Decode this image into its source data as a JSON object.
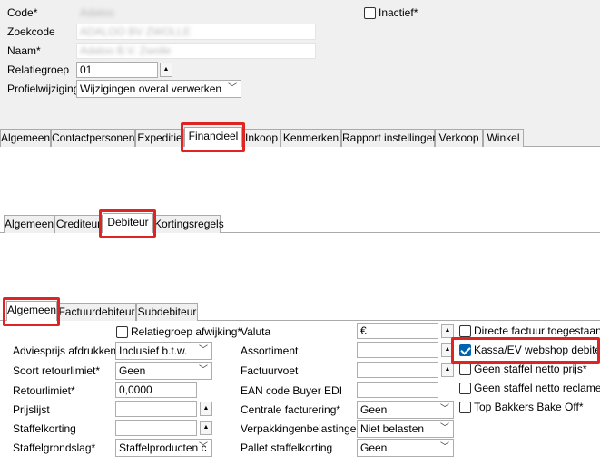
{
  "header": {
    "code_label": "Code*",
    "code_value": "Adaloo",
    "zoekcode_label": "Zoekcode",
    "zoekcode_value": "ADALOO BV ZWOLLE",
    "naam_label": "Naam*",
    "naam_value": "Adaloo B.V. Zwolle",
    "relatiegroep_label": "Relatiegroep",
    "relatiegroep_value": "01",
    "profielwijziging_label": "Profielwijziging*",
    "profielwijziging_value": "Wijzigingen overal verwerken",
    "inactief_label": "Inactief*",
    "inactief_checked": false
  },
  "main_tabs": [
    "Algemeen",
    "Contactpersonen",
    "Expeditie",
    "Financieel",
    "Inkoop",
    "Kenmerken",
    "Rapport instellingen",
    "Verkoop",
    "Winkel"
  ],
  "main_tab_active": "Financieel",
  "fin_tabs": [
    "Algemeen",
    "Crediteur",
    "Debiteur",
    "Kortingsregels"
  ],
  "fin_tab_active": "Debiteur",
  "deb_tabs": [
    "Algemeen",
    "Factuurdebiteur",
    "Subdebiteur"
  ],
  "deb_tab_active": "Algemeen",
  "form": {
    "relatiegroep_afwijking_label": "Relatiegroep afwijking*",
    "adviesprijs_label": "Adviesprijs afdrukken*",
    "adviesprijs_value": "Inclusief b.t.w.",
    "soort_retourlimiet_label": "Soort retourlimiet*",
    "soort_retourlimiet_value": "Geen",
    "retourlimiet_label": "Retourlimiet*",
    "retourlimiet_value": "0,0000",
    "prijslijst_label": "Prijslijst",
    "prijslijst_value": "",
    "staffelkorting_label": "Staffelkorting",
    "staffelkorting_value": "",
    "staffelgrondslag_label": "Staffelgrondslag*",
    "staffelgrondslag_value": "Staffelproducten c",
    "valuta_label": "Valuta",
    "valuta_value": "€",
    "assortiment_label": "Assortiment",
    "assortiment_value": "",
    "factuurvoet_label": "Factuurvoet",
    "factuurvoet_value": "",
    "ean_label": "EAN code Buyer EDI",
    "ean_value": "",
    "centrale_label": "Centrale facturering*",
    "centrale_value": "Geen",
    "verpakking_label": "Verpakkingenbelastingen*",
    "verpakking_value": "Niet belasten",
    "pallet_label": "Pallet staffelkorting",
    "pallet_value": "Geen"
  },
  "checks": {
    "directe_factuur": "Directe factuur toegestaan*",
    "kassa_ev": "Kassa/EV webshop debiteur",
    "geen_staffel_prijs": "Geen staffel netto prijs*",
    "geen_staffel_reclame": "Geen staffel netto reclame*",
    "top_bakkers": "Top Bakkers Bake Off*"
  },
  "colors": {
    "highlight": "#e02424",
    "check_blue": "#0063b1"
  }
}
